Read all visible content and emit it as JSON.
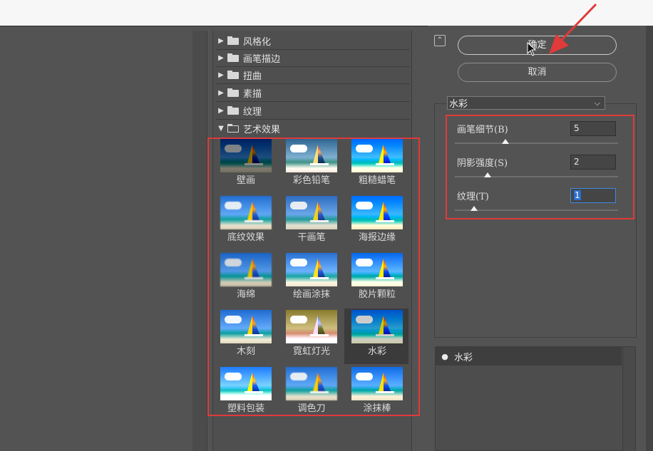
{
  "categories": [
    {
      "label": "风格化",
      "expanded": false
    },
    {
      "label": "画笔描边",
      "expanded": false
    },
    {
      "label": "扭曲",
      "expanded": false
    },
    {
      "label": "素描",
      "expanded": false
    },
    {
      "label": "纹理",
      "expanded": false
    },
    {
      "label": "艺术效果",
      "expanded": true
    }
  ],
  "filters": [
    {
      "label": "壁画",
      "style": "dark"
    },
    {
      "label": "彩色铅笔",
      "style": "pencil"
    },
    {
      "label": "粗糙蜡笔",
      "style": "rough"
    },
    {
      "label": "底纹效果",
      "style": "texture"
    },
    {
      "label": "干画笔",
      "style": "plain"
    },
    {
      "label": "海报边缘",
      "style": "poster"
    },
    {
      "label": "海绵",
      "style": "sponge"
    },
    {
      "label": "绘画涂抹",
      "style": "smudge"
    },
    {
      "label": "胶片颗粒",
      "style": "grain"
    },
    {
      "label": "木刻",
      "style": "wood"
    },
    {
      "label": "霓虹灯光",
      "style": "neon"
    },
    {
      "label": "水彩",
      "style": "water",
      "selected": true
    },
    {
      "label": "塑料包装",
      "style": "plastic"
    },
    {
      "label": "调色刀",
      "style": "palette"
    },
    {
      "label": "涂抹棒",
      "style": "stick"
    }
  ],
  "buttons": {
    "ok": "确定",
    "cancel": "取消"
  },
  "filter_select": {
    "value": "水彩"
  },
  "params": [
    {
      "label": "画笔细节(B)",
      "value": "5",
      "slider_fraction": 0.31
    },
    {
      "label": "阴影强度(S)",
      "value": "2",
      "slider_fraction": 0.2
    },
    {
      "label": "纹理(T)",
      "value": "1",
      "slider_fraction": 0.12,
      "focused": true
    }
  ],
  "layers": [
    {
      "label": "水彩",
      "visible": true
    }
  ],
  "colors": {
    "highlight": "#e03a3a",
    "accent": "#2a6fd0"
  }
}
